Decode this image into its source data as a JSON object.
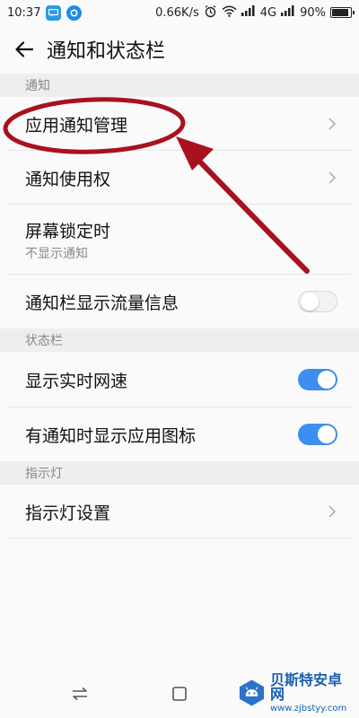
{
  "status_bar": {
    "time": "10:37",
    "network_speed": "0.66K/s",
    "signal_text": "4G",
    "battery": "90%",
    "battery_level": 0.9,
    "icons": [
      "message-app-icon",
      "cloud-app-icon",
      "alarm-icon",
      "wifi-icon",
      "signal-icon",
      "battery-icon"
    ]
  },
  "header": {
    "title": "通知和状态栏",
    "back_icon": "back-arrow-icon"
  },
  "sections": {
    "notifications": {
      "header": "通知",
      "app_notification_management": "应用通知管理",
      "notification_access": "通知使用权",
      "lock_screen": {
        "label": "屏幕锁定时",
        "value": "不显示通知"
      },
      "show_traffic_info": {
        "label": "通知栏显示流量信息",
        "enabled": false
      }
    },
    "status_bar": {
      "header": "状态栏",
      "realtime_speed": {
        "label": "显示实时网速",
        "enabled": true
      },
      "show_app_icon": {
        "label": "有通知时显示应用图标",
        "enabled": true
      }
    },
    "indicator": {
      "header": "指示灯",
      "settings": "指示灯设置"
    }
  },
  "colors": {
    "toggle_on": "#3d8ef0",
    "annotation": "#a8121e",
    "section_bg": "#eeeeee"
  },
  "watermark": {
    "name": "贝斯特安卓网",
    "url": "www.zjbstyy.com"
  }
}
